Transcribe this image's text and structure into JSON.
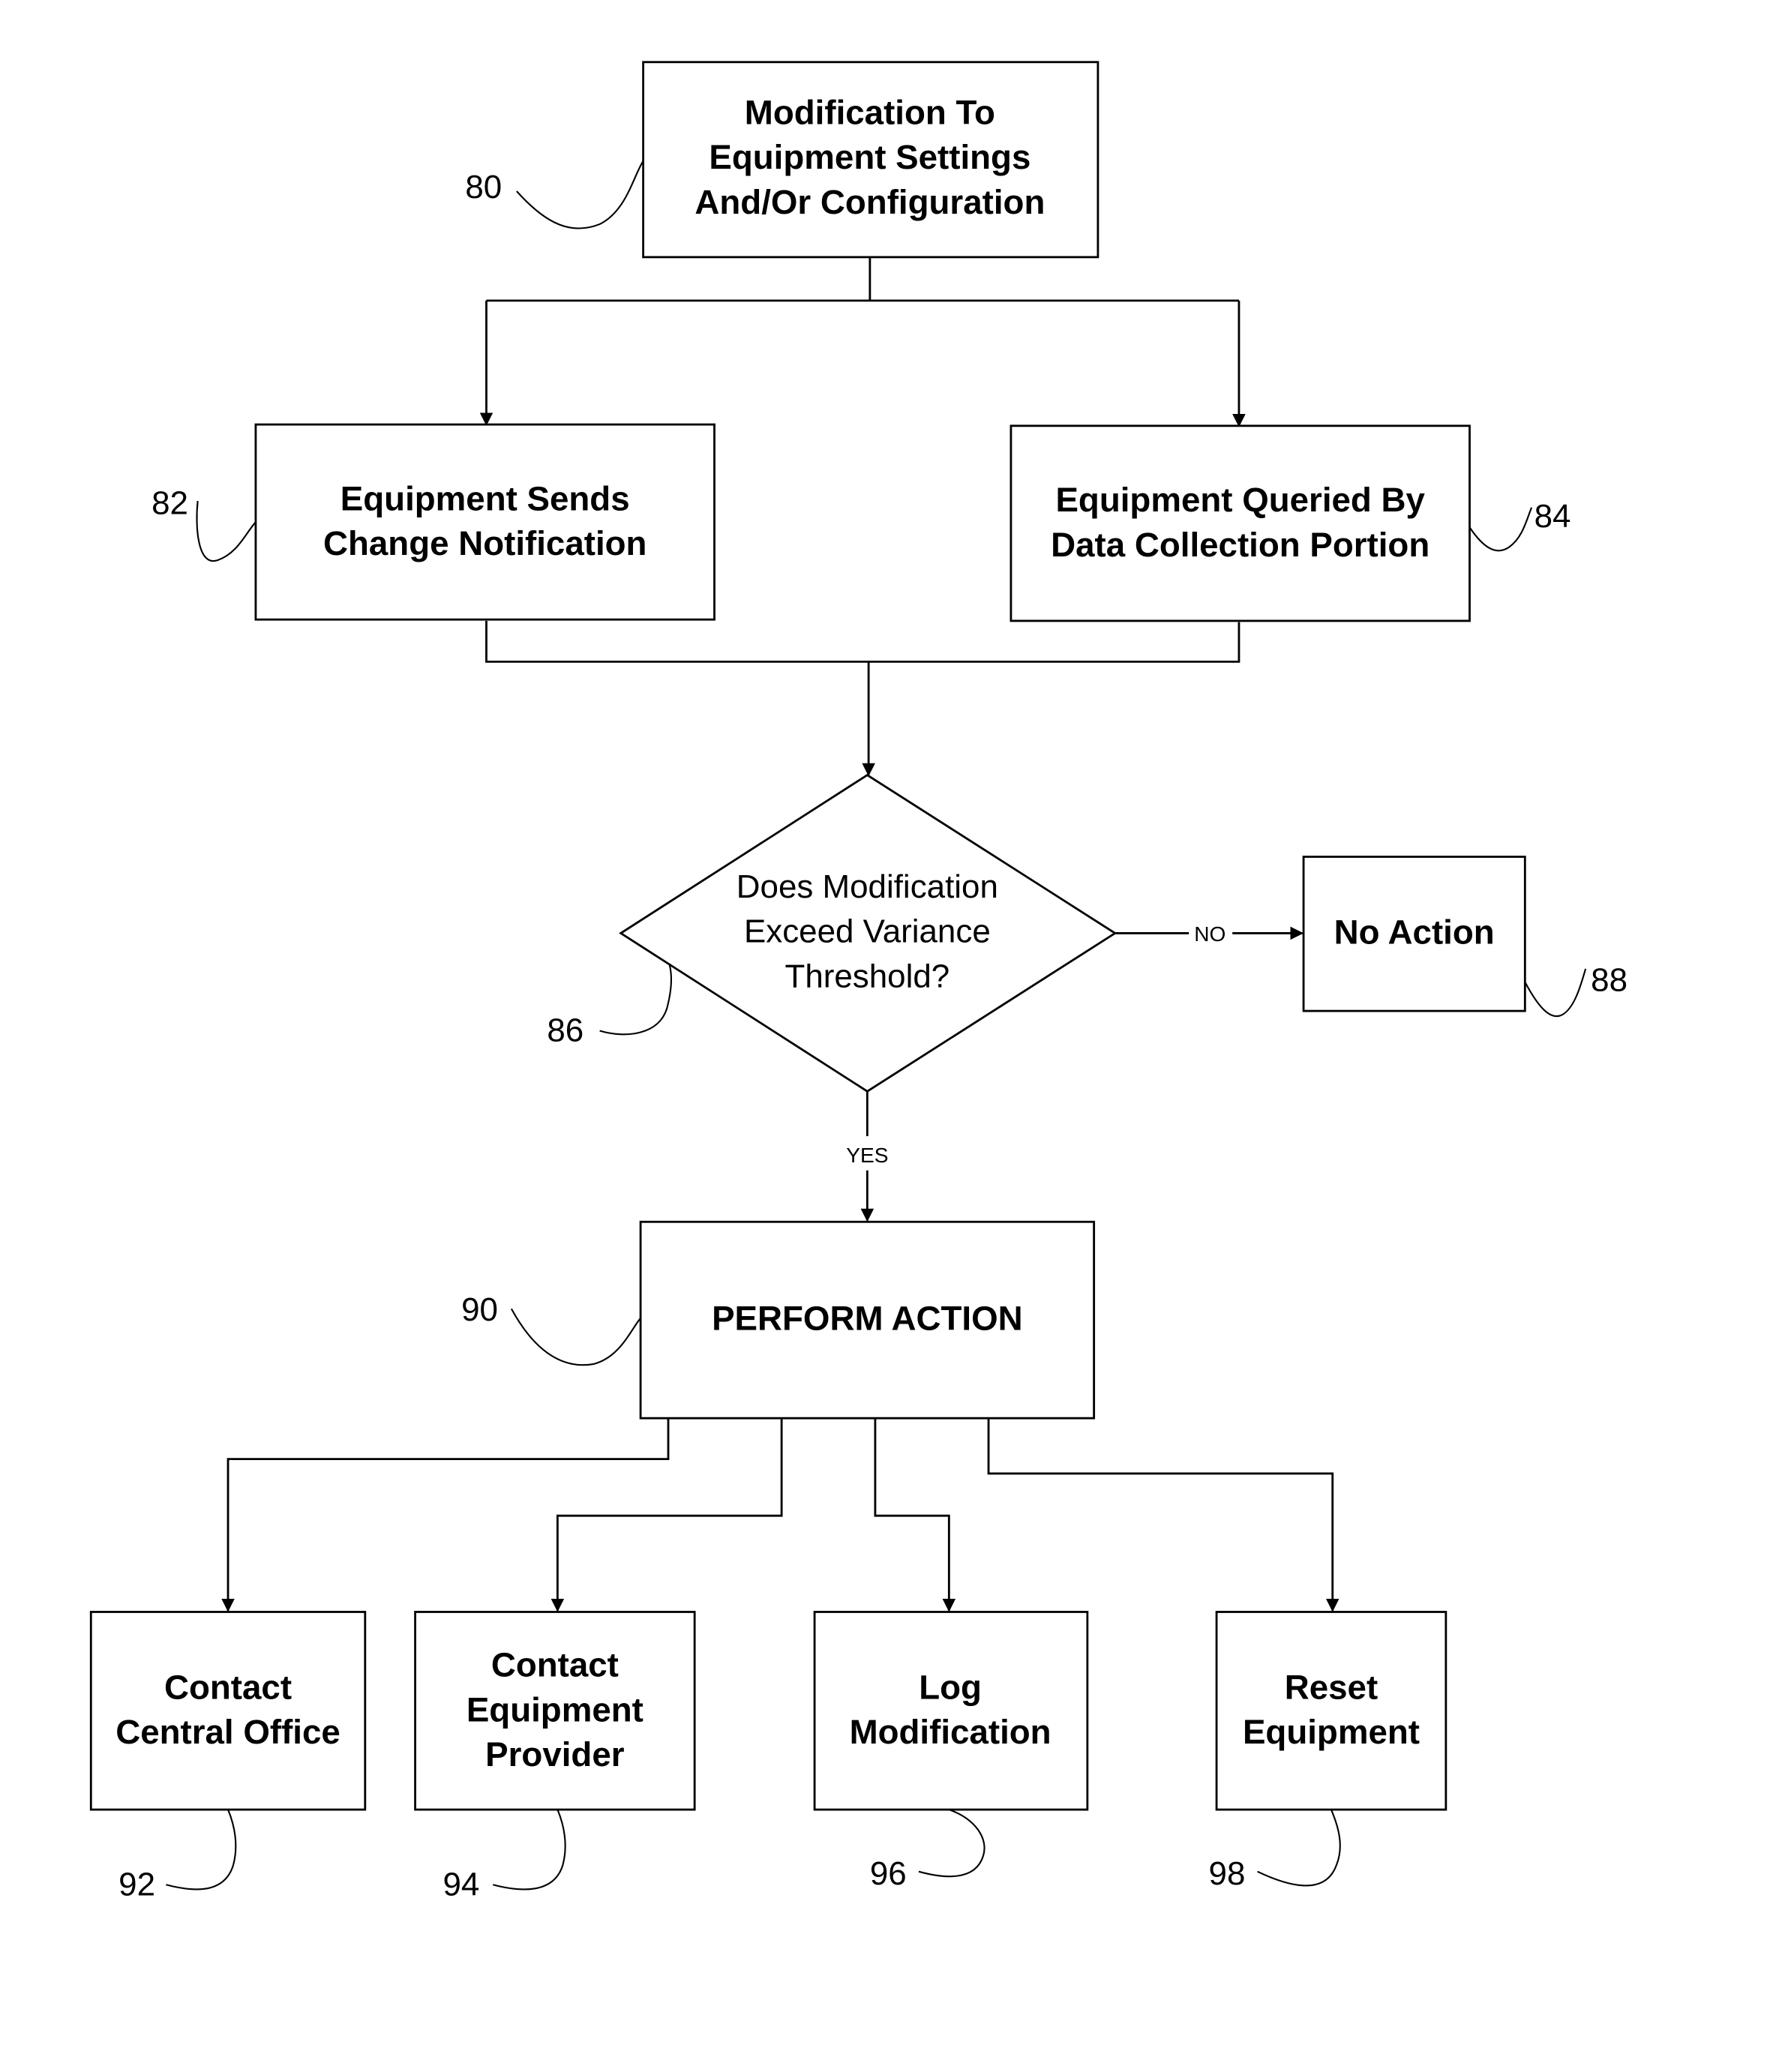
{
  "figure": {
    "nodes": {
      "n80": {
        "ref": "80",
        "lines": [
          "Modification To",
          "Equipment Settings",
          "And/Or Configuration"
        ]
      },
      "n82": {
        "ref": "82",
        "lines": [
          "Equipment Sends",
          "Change Notification"
        ]
      },
      "n84": {
        "ref": "84",
        "lines": [
          "Equipment Queried By",
          "Data Collection Portion"
        ]
      },
      "n86": {
        "ref": "86",
        "lines": [
          "Does Modification",
          "Exceed Variance",
          "Threshold?"
        ]
      },
      "n88": {
        "ref": "88",
        "lines": [
          "No Action"
        ]
      },
      "n90": {
        "ref": "90",
        "lines": [
          "PERFORM ACTION"
        ]
      },
      "n92": {
        "ref": "92",
        "lines": [
          "Contact",
          "Central Office"
        ]
      },
      "n94": {
        "ref": "94",
        "lines": [
          "Contact",
          "Equipment",
          "Provider"
        ]
      },
      "n96": {
        "ref": "96",
        "lines": [
          "Log",
          "Modification"
        ]
      },
      "n98": {
        "ref": "98",
        "lines": [
          "Reset",
          "Equipment"
        ]
      }
    },
    "edges": {
      "no_label": "NO",
      "yes_label": "YES"
    }
  }
}
